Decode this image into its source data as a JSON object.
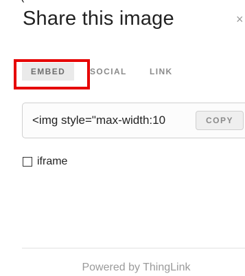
{
  "dialog": {
    "top_fragment": "(",
    "title": "Share this image",
    "close_glyph": "×"
  },
  "tabs": [
    {
      "label": "EMBED",
      "active": true
    },
    {
      "label": "SOCIAL",
      "active": false
    },
    {
      "label": "LINK",
      "active": false
    }
  ],
  "embed": {
    "code": "<img style=\"max-width:10",
    "copy_label": "COPY"
  },
  "options": {
    "iframe_label": "iframe",
    "iframe_checked": false
  },
  "footer": {
    "powered_by": "Powered by ThingLink"
  },
  "colors": {
    "highlight": "#e60000",
    "active_tab_bg": "#eaeaea"
  }
}
